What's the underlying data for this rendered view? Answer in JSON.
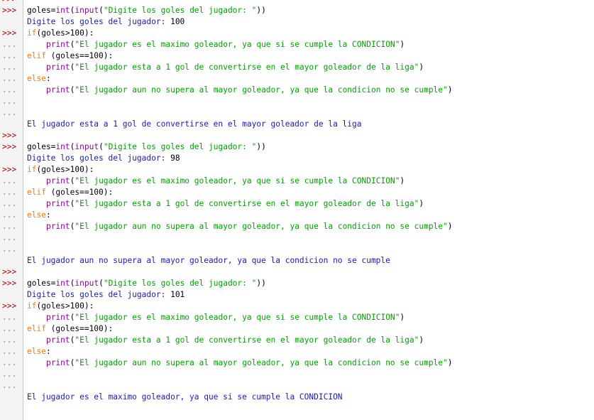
{
  "colors": {
    "keyword": "#ff7700",
    "builtin": "#900090",
    "string": "#00a000",
    "stdout": "#1a1ab8",
    "prompt_main": "#c00000",
    "prompt_cont": "#7f7f7f"
  },
  "lines": [
    {
      "prompt": ">>>",
      "tokens": []
    },
    {
      "prompt": ">>>",
      "tokens": [
        {
          "c": "plain",
          "t": "goles="
        },
        {
          "c": "bi",
          "t": "int"
        },
        {
          "c": "plain",
          "t": "("
        },
        {
          "c": "bi",
          "t": "input"
        },
        {
          "c": "plain",
          "t": "("
        },
        {
          "c": "str",
          "t": "\"Digite los goles del jugador: \""
        },
        {
          "c": "plain",
          "t": "))"
        }
      ]
    },
    {
      "prompt": "",
      "tokens": [
        {
          "c": "out",
          "t": "Digite los goles del jugador: "
        },
        {
          "c": "plain",
          "t": "100"
        }
      ]
    },
    {
      "prompt": ">>>",
      "tokens": [
        {
          "c": "kw",
          "t": "if"
        },
        {
          "c": "plain",
          "t": "(goles>100):"
        }
      ]
    },
    {
      "prompt": "...",
      "tokens": [
        {
          "c": "plain",
          "t": "    "
        },
        {
          "c": "bi",
          "t": "print"
        },
        {
          "c": "plain",
          "t": "("
        },
        {
          "c": "str",
          "t": "\"El jugador es el maximo goleador, ya que si se cumple la CONDICION\""
        },
        {
          "c": "plain",
          "t": ")"
        }
      ]
    },
    {
      "prompt": "...",
      "tokens": [
        {
          "c": "kw",
          "t": "elif"
        },
        {
          "c": "plain",
          "t": " (goles==100):"
        }
      ]
    },
    {
      "prompt": "...",
      "tokens": [
        {
          "c": "plain",
          "t": "    "
        },
        {
          "c": "bi",
          "t": "print"
        },
        {
          "c": "plain",
          "t": "("
        },
        {
          "c": "str",
          "t": "\"El jugador esta a 1 gol de convertirse en el mayor goleador de la liga\""
        },
        {
          "c": "plain",
          "t": ")"
        }
      ]
    },
    {
      "prompt": "...",
      "tokens": [
        {
          "c": "kw",
          "t": "else"
        },
        {
          "c": "plain",
          "t": ":"
        }
      ]
    },
    {
      "prompt": "...",
      "tokens": [
        {
          "c": "plain",
          "t": "    "
        },
        {
          "c": "bi",
          "t": "print"
        },
        {
          "c": "plain",
          "t": "("
        },
        {
          "c": "str",
          "t": "\"El jugador aun no supera al mayor goleador, ya que la condicion no se cumple\""
        },
        {
          "c": "plain",
          "t": ")"
        }
      ]
    },
    {
      "prompt": "...",
      "tokens": []
    },
    {
      "prompt": "...",
      "tokens": []
    },
    {
      "prompt": "",
      "tokens": [
        {
          "c": "out",
          "t": "El jugador esta a 1 gol de convertirse en el mayor goleador de la liga"
        }
      ]
    },
    {
      "prompt": ">>>",
      "tokens": []
    },
    {
      "prompt": ">>>",
      "tokens": [
        {
          "c": "plain",
          "t": "goles="
        },
        {
          "c": "bi",
          "t": "int"
        },
        {
          "c": "plain",
          "t": "("
        },
        {
          "c": "bi",
          "t": "input"
        },
        {
          "c": "plain",
          "t": "("
        },
        {
          "c": "str",
          "t": "\"Digite los goles del jugador: \""
        },
        {
          "c": "plain",
          "t": "))"
        }
      ]
    },
    {
      "prompt": "",
      "tokens": [
        {
          "c": "out",
          "t": "Digite los goles del jugador: "
        },
        {
          "c": "plain",
          "t": "98"
        }
      ]
    },
    {
      "prompt": ">>>",
      "tokens": [
        {
          "c": "kw",
          "t": "if"
        },
        {
          "c": "plain",
          "t": "(goles>100):"
        }
      ]
    },
    {
      "prompt": "...",
      "tokens": [
        {
          "c": "plain",
          "t": "    "
        },
        {
          "c": "bi",
          "t": "print"
        },
        {
          "c": "plain",
          "t": "("
        },
        {
          "c": "str",
          "t": "\"El jugador es el maximo goleador, ya que si se cumple la CONDICION\""
        },
        {
          "c": "plain",
          "t": ")"
        }
      ]
    },
    {
      "prompt": "...",
      "tokens": [
        {
          "c": "kw",
          "t": "elif"
        },
        {
          "c": "plain",
          "t": " (goles==100):"
        }
      ]
    },
    {
      "prompt": "...",
      "tokens": [
        {
          "c": "plain",
          "t": "    "
        },
        {
          "c": "bi",
          "t": "print"
        },
        {
          "c": "plain",
          "t": "("
        },
        {
          "c": "str",
          "t": "\"El jugador esta a 1 gol de convertirse en el mayor goleador de la liga\""
        },
        {
          "c": "plain",
          "t": ")"
        }
      ]
    },
    {
      "prompt": "...",
      "tokens": [
        {
          "c": "kw",
          "t": "else"
        },
        {
          "c": "plain",
          "t": ":"
        }
      ]
    },
    {
      "prompt": "...",
      "tokens": [
        {
          "c": "plain",
          "t": "    "
        },
        {
          "c": "bi",
          "t": "print"
        },
        {
          "c": "plain",
          "t": "("
        },
        {
          "c": "str",
          "t": "\"El jugador aun no supera al mayor goleador, ya que la condicion no se cumple\""
        },
        {
          "c": "plain",
          "t": ")"
        }
      ]
    },
    {
      "prompt": "...",
      "tokens": []
    },
    {
      "prompt": "...",
      "tokens": []
    },
    {
      "prompt": "",
      "tokens": [
        {
          "c": "out",
          "t": "El jugador aun no supera al mayor goleador, ya que la condicion no se cumple"
        }
      ]
    },
    {
      "prompt": ">>>",
      "tokens": []
    },
    {
      "prompt": ">>>",
      "tokens": [
        {
          "c": "plain",
          "t": "goles="
        },
        {
          "c": "bi",
          "t": "int"
        },
        {
          "c": "plain",
          "t": "("
        },
        {
          "c": "bi",
          "t": "input"
        },
        {
          "c": "plain",
          "t": "("
        },
        {
          "c": "str",
          "t": "\"Digite los goles del jugador: \""
        },
        {
          "c": "plain",
          "t": "))"
        }
      ]
    },
    {
      "prompt": "",
      "tokens": [
        {
          "c": "out",
          "t": "Digite los goles del jugador: "
        },
        {
          "c": "plain",
          "t": "101"
        }
      ]
    },
    {
      "prompt": ">>>",
      "tokens": [
        {
          "c": "kw",
          "t": "if"
        },
        {
          "c": "plain",
          "t": "(goles>100):"
        }
      ]
    },
    {
      "prompt": "...",
      "tokens": [
        {
          "c": "plain",
          "t": "    "
        },
        {
          "c": "bi",
          "t": "print"
        },
        {
          "c": "plain",
          "t": "("
        },
        {
          "c": "str",
          "t": "\"El jugador es el maximo goleador, ya que si se cumple la CONDICION\""
        },
        {
          "c": "plain",
          "t": ")"
        }
      ]
    },
    {
      "prompt": "...",
      "tokens": [
        {
          "c": "kw",
          "t": "elif"
        },
        {
          "c": "plain",
          "t": " (goles==100):"
        }
      ]
    },
    {
      "prompt": "...",
      "tokens": [
        {
          "c": "plain",
          "t": "    "
        },
        {
          "c": "bi",
          "t": "print"
        },
        {
          "c": "plain",
          "t": "("
        },
        {
          "c": "str",
          "t": "\"El jugador esta a 1 gol de convertirse en el mayor goleador de la liga\""
        },
        {
          "c": "plain",
          "t": ")"
        }
      ]
    },
    {
      "prompt": "...",
      "tokens": [
        {
          "c": "kw",
          "t": "else"
        },
        {
          "c": "plain",
          "t": ":"
        }
      ]
    },
    {
      "prompt": "...",
      "tokens": [
        {
          "c": "plain",
          "t": "    "
        },
        {
          "c": "bi",
          "t": "print"
        },
        {
          "c": "plain",
          "t": "("
        },
        {
          "c": "str",
          "t": "\"El jugador aun no supera al mayor goleador, ya que la condicion no se cumple\""
        },
        {
          "c": "plain",
          "t": ")"
        }
      ]
    },
    {
      "prompt": "...",
      "tokens": []
    },
    {
      "prompt": "...",
      "tokens": []
    },
    {
      "prompt": "",
      "tokens": [
        {
          "c": "out",
          "t": "El jugador es el maximo goleador, ya que si se cumple la CONDICION"
        }
      ]
    }
  ]
}
